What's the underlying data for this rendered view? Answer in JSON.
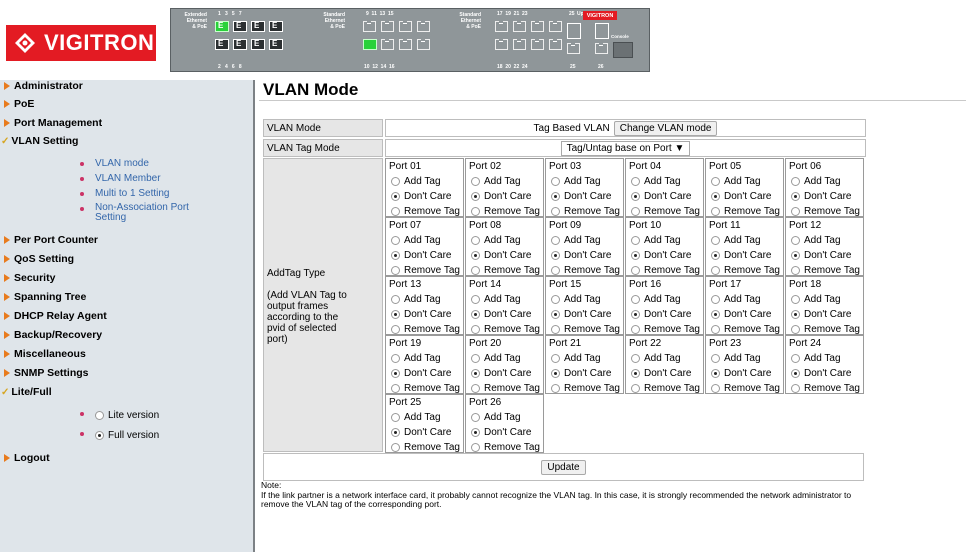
{
  "header": {
    "brand": "VIGITRON",
    "panel": {
      "group1": "Extended\nEthernet\n& PoE",
      "group2": "Standard\nEthernet\n& PoE",
      "group3": "Standard\nEthernet\n& PoE",
      "uplink": "Uplink",
      "console": "Console",
      "mini_logo": "VIGITRON",
      "top_nums_1": "1   3   5   7",
      "bot_nums_1": "2   4   6   8",
      "top_nums_2": "9  11  13  15",
      "bot_nums_2": "10  12  14  16",
      "top_nums_3": "17  19  21  23",
      "bot_nums_3": "18  20  22  24",
      "top_25": "25",
      "top_26": "26",
      "bot_25": "25",
      "bot_26": "26",
      "port_letter": "E"
    }
  },
  "sidebar": {
    "items": [
      {
        "label": "Administrator",
        "icon": "arrow"
      },
      {
        "label": "PoE",
        "icon": "arrow"
      },
      {
        "label": "Port Management",
        "icon": "arrow"
      },
      {
        "label": "VLAN Setting",
        "icon": "check"
      },
      {
        "label": "Per Port Counter",
        "icon": "arrow"
      },
      {
        "label": "QoS Setting",
        "icon": "arrow"
      },
      {
        "label": "Security",
        "icon": "arrow"
      },
      {
        "label": "Spanning Tree",
        "icon": "arrow"
      },
      {
        "label": "DHCP Relay Agent",
        "icon": "arrow"
      },
      {
        "label": "Backup/Recovery",
        "icon": "arrow"
      },
      {
        "label": "Miscellaneous",
        "icon": "arrow"
      },
      {
        "label": "SNMP Settings",
        "icon": "arrow"
      },
      {
        "label": "Lite/Full",
        "icon": "check"
      },
      {
        "label": "Logout",
        "icon": "arrow"
      }
    ],
    "vlan_sub": [
      "VLAN mode",
      "VLAN Member",
      "Multi to 1 Setting",
      "Non-Association Port Setting"
    ],
    "lite_label": "Lite version",
    "full_label": "Full version",
    "selected_version": "full"
  },
  "main": {
    "title": "VLAN Mode",
    "vlan_mode_label": "VLAN Mode",
    "vlan_mode_value": "Tag Based VLAN",
    "change_button": "Change VLAN mode",
    "tag_mode_label": "VLAN Tag Mode",
    "tag_mode_value": "Tag/Untag base on Port ▼",
    "addtag_label": "AddTag Type",
    "addtag_desc": "(Add VLAN Tag to output frames according to the pvid of selected port)",
    "options": [
      "Add Tag",
      "Don't Care",
      "Remove Tag"
    ],
    "ports": [
      {
        "name": "Port 01",
        "selected": 1
      },
      {
        "name": "Port 02",
        "selected": 1
      },
      {
        "name": "Port 03",
        "selected": 1
      },
      {
        "name": "Port 04",
        "selected": 1
      },
      {
        "name": "Port 05",
        "selected": 1
      },
      {
        "name": "Port 06",
        "selected": 1
      },
      {
        "name": "Port 07",
        "selected": 1
      },
      {
        "name": "Port 08",
        "selected": 1
      },
      {
        "name": "Port 09",
        "selected": 1
      },
      {
        "name": "Port 10",
        "selected": 1
      },
      {
        "name": "Port 11",
        "selected": 1
      },
      {
        "name": "Port 12",
        "selected": 1
      },
      {
        "name": "Port 13",
        "selected": 1
      },
      {
        "name": "Port 14",
        "selected": 1
      },
      {
        "name": "Port 15",
        "selected": 1
      },
      {
        "name": "Port 16",
        "selected": 1
      },
      {
        "name": "Port 17",
        "selected": 1
      },
      {
        "name": "Port 18",
        "selected": 1
      },
      {
        "name": "Port 19",
        "selected": 1
      },
      {
        "name": "Port 20",
        "selected": 1
      },
      {
        "name": "Port 21",
        "selected": 1
      },
      {
        "name": "Port 22",
        "selected": 1
      },
      {
        "name": "Port 23",
        "selected": 1
      },
      {
        "name": "Port 24",
        "selected": 1
      },
      {
        "name": "Port 25",
        "selected": 1
      },
      {
        "name": "Port 26",
        "selected": 1
      }
    ],
    "update_button": "Update",
    "note_title": "Note:",
    "note_text": "If the link partner is a network interface card, it probably cannot recognize the VLAN tag. In this case, it is strongly recommended the network administrator to remove the VLAN tag of the corresponding port."
  },
  "colors": {
    "brand_red": "#e31b23",
    "sidebar_bg": "#dfe5ea",
    "link_blue": "#3366aa",
    "arrow_orange": "#e87b1d",
    "port_green": "#29d13a"
  }
}
